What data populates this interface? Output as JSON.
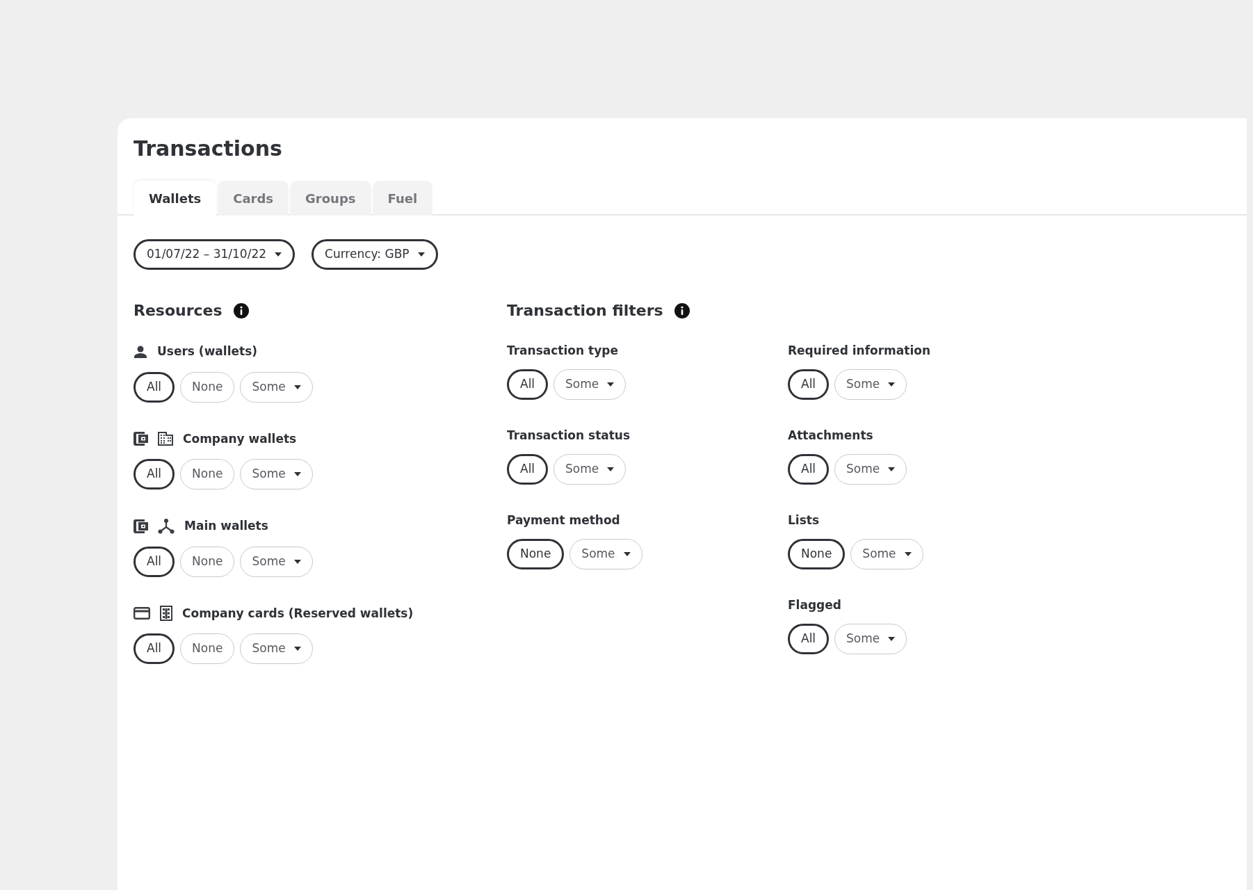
{
  "page": {
    "title": "Transactions"
  },
  "tabs": [
    {
      "label": "Wallets",
      "selected": true
    },
    {
      "label": "Cards",
      "selected": false
    },
    {
      "label": "Groups",
      "selected": false
    },
    {
      "label": "Fuel",
      "selected": false
    }
  ],
  "toolbar": [
    {
      "label": "01/07/22 – 31/10/22"
    },
    {
      "label": "Currency: GBP"
    }
  ],
  "resources": {
    "title": "Resources",
    "groups": [
      {
        "label": "Users (wallets)",
        "kind": "users",
        "options": [
          {
            "label": "All",
            "kind": "option",
            "selected": true
          },
          {
            "label": "None",
            "kind": "option",
            "selected": false
          },
          {
            "label": "Some",
            "kind": "dropdown",
            "selected": false
          }
        ]
      },
      {
        "label": "Company wallets",
        "kind": "company-wallets",
        "options": [
          {
            "label": "All",
            "kind": "option",
            "selected": true
          },
          {
            "label": "None",
            "kind": "option",
            "selected": false
          },
          {
            "label": "Some",
            "kind": "dropdown",
            "selected": false
          }
        ]
      },
      {
        "label": "Main wallets",
        "kind": "main-wallets",
        "options": [
          {
            "label": "All",
            "kind": "option",
            "selected": true
          },
          {
            "label": "None",
            "kind": "option",
            "selected": false
          },
          {
            "label": "Some",
            "kind": "dropdown",
            "selected": false
          }
        ]
      },
      {
        "label": "Company cards (Reserved wallets)",
        "kind": "company-cards",
        "options": [
          {
            "label": "All",
            "kind": "option",
            "selected": true
          },
          {
            "label": "None",
            "kind": "option",
            "selected": false
          },
          {
            "label": "Some",
            "kind": "dropdown",
            "selected": false
          }
        ]
      }
    ]
  },
  "transaction_filters": {
    "title": "Transaction filters",
    "columns": [
      [
        {
          "label": "Transaction type",
          "options": [
            {
              "label": "All",
              "kind": "option",
              "selected": true
            },
            {
              "label": "Some",
              "kind": "dropdown",
              "selected": false
            }
          ]
        },
        {
          "label": "Transaction status",
          "options": [
            {
              "label": "All",
              "kind": "option",
              "selected": true
            },
            {
              "label": "Some",
              "kind": "dropdown",
              "selected": false
            }
          ]
        },
        {
          "label": "Payment method",
          "options": [
            {
              "label": "None",
              "kind": "option",
              "selected": true
            },
            {
              "label": "Some",
              "kind": "dropdown",
              "selected": false
            }
          ]
        }
      ],
      [
        {
          "label": "Required information",
          "options": [
            {
              "label": "All",
              "kind": "option",
              "selected": true
            },
            {
              "label": "Some",
              "kind": "dropdown",
              "selected": false
            }
          ]
        },
        {
          "label": "Attachments",
          "options": [
            {
              "label": "All",
              "kind": "option",
              "selected": true
            },
            {
              "label": "Some",
              "kind": "dropdown",
              "selected": false
            }
          ]
        },
        {
          "label": "Lists",
          "options": [
            {
              "label": "None",
              "kind": "option",
              "selected": true
            },
            {
              "label": "Some",
              "kind": "dropdown",
              "selected": false
            }
          ]
        },
        {
          "label": "Flagged",
          "options": [
            {
              "label": "All",
              "kind": "option",
              "selected": true
            },
            {
              "label": "Some",
              "kind": "dropdown",
              "selected": false
            }
          ]
        }
      ]
    ]
  }
}
